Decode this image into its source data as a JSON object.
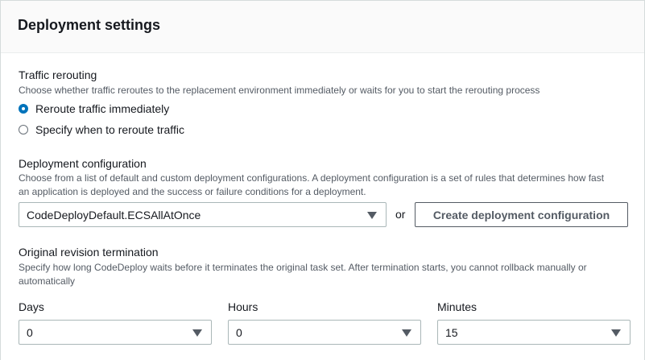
{
  "panel": {
    "title": "Deployment settings"
  },
  "traffic": {
    "label": "Traffic rerouting",
    "description": "Choose whether traffic reroutes to the replacement environment immediately or waits for you to start the rerouting process",
    "options": [
      {
        "label": "Reroute traffic immediately",
        "selected": true
      },
      {
        "label": "Specify when to reroute traffic",
        "selected": false
      }
    ]
  },
  "deployment_config": {
    "label": "Deployment configuration",
    "description_line1": "Choose from a list of default and custom deployment configurations. A deployment configuration is a set of rules that determines how fast",
    "description_line2": "an application is deployed and the success or failure conditions for a deployment.",
    "selected": "CodeDeployDefault.ECSAllAtOnce",
    "or_text": "or",
    "create_button": "Create deployment configuration"
  },
  "termination": {
    "label": "Original revision termination",
    "description_line1": "Specify how long CodeDeploy waits before it terminates the original task set. After termination starts, you cannot rollback manually or",
    "description_line2": "automatically",
    "days": {
      "label": "Days",
      "value": "0"
    },
    "hours": {
      "label": "Hours",
      "value": "0"
    },
    "minutes": {
      "label": "Minutes",
      "value": "15"
    }
  },
  "colors": {
    "accent": "#0073bb",
    "text": "#16191f",
    "muted": "#545b64",
    "border": "#aab7b8"
  },
  "icons": {
    "select_caret": "caret-down-icon",
    "radio": "radio-icon"
  }
}
